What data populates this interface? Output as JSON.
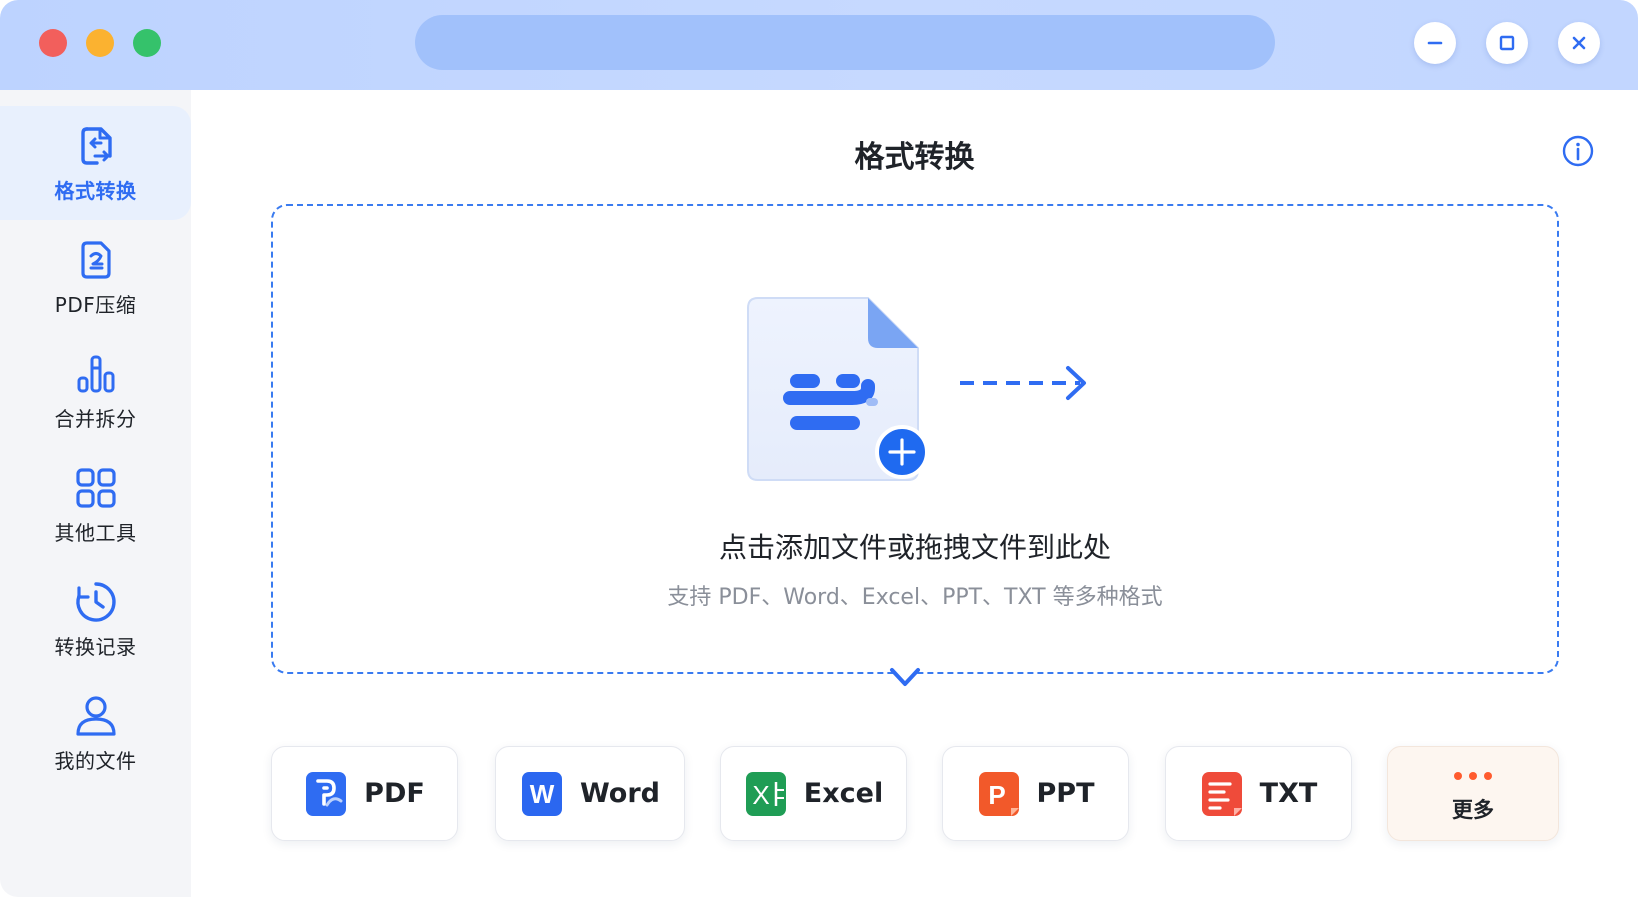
{
  "titlebar": {
    "buttons": {
      "minimize": "minimize-icon",
      "maximize": "maximize-icon",
      "close": "close-icon"
    }
  },
  "sidebar": {
    "items": [
      {
        "label": "格式转换",
        "icon": "convert-icon",
        "active": true
      },
      {
        "label": "PDF压缩",
        "icon": "compress-icon",
        "active": false
      },
      {
        "label": "合并拆分",
        "icon": "merge-split-icon",
        "active": false
      },
      {
        "label": "其他工具",
        "icon": "grid-tools-icon",
        "active": false
      },
      {
        "label": "转换记录",
        "icon": "history-icon",
        "active": false
      },
      {
        "label": "我的文件",
        "icon": "user-icon",
        "active": false
      }
    ]
  },
  "main": {
    "title": "格式转换",
    "dropzone": {
      "main_text": "点击添加文件或拖拽文件到此处",
      "sub_text": "支持 PDF、Word、Excel、PPT、TXT 等多种格式"
    },
    "formats": [
      {
        "label": "PDF",
        "icon": "pdf-icon"
      },
      {
        "label": "Word",
        "icon": "word-icon",
        "letter": "W"
      },
      {
        "label": "Excel",
        "icon": "excel-icon",
        "letter": "X"
      },
      {
        "label": "PPT",
        "icon": "ppt-icon",
        "letter": "P"
      },
      {
        "label": "TXT",
        "icon": "txt-icon"
      },
      {
        "label": "更多",
        "icon": "more-dots-icon"
      }
    ]
  },
  "colors": {
    "accent": "#2f6cf2",
    "titlebar": "#c2d6ff",
    "searchbar": "#a1c1fb",
    "close_dot": "#f25f5c",
    "minimize_dot": "#fbb230",
    "zoom_dot": "#35c26b",
    "word": "#2b67f0",
    "excel": "#1f9d55",
    "ppt": "#f2592a",
    "txt": "#ef4b3a",
    "more": "#ff5b2e"
  }
}
